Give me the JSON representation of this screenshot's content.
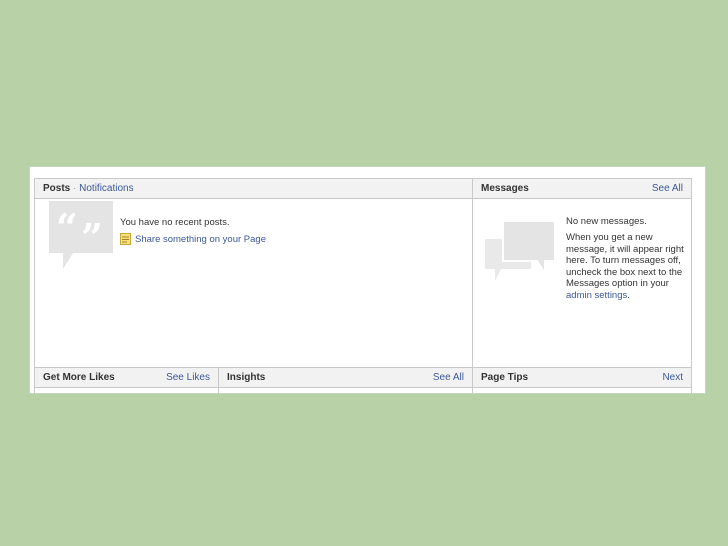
{
  "posts": {
    "title": "Posts",
    "separator": "·",
    "notifications_link": "Notifications",
    "empty_text": "You have no recent posts.",
    "share_link": "Share something on your Page"
  },
  "messages": {
    "title": "Messages",
    "see_all": "See All",
    "empty_heading": "No new messages.",
    "body_text": "When you get a new message, it will appear right here. To turn messages off, uncheck the box next to the Messages option in your",
    "admin_link": "admin settings",
    "period": "."
  },
  "get_more_likes": {
    "title": "Get More Likes",
    "link": "See Likes"
  },
  "insights": {
    "title": "Insights",
    "link": "See All"
  },
  "page_tips": {
    "title": "Page Tips",
    "link": "Next"
  },
  "icons": {
    "quote": "quote-bubble-icon",
    "note": "note-icon",
    "chat": "chat-bubbles-icon"
  },
  "colors": {
    "background": "#b9d1a6",
    "link": "#3b5998",
    "header_bg": "#f2f2f2",
    "icon_gray": "#e4e4e4"
  }
}
